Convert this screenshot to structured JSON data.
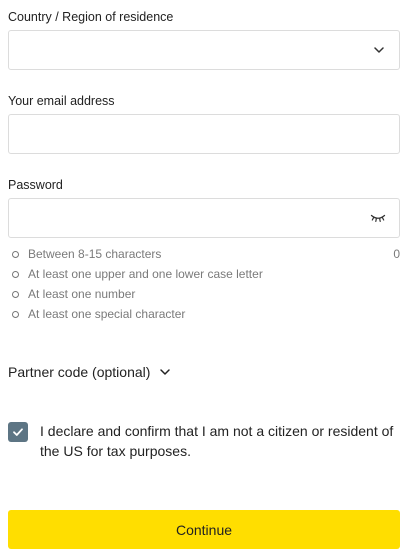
{
  "country": {
    "label": "Country / Region of residence",
    "value": ""
  },
  "email": {
    "label": "Your email address",
    "value": ""
  },
  "password": {
    "label": "Password",
    "value": "",
    "char_count": "0",
    "rules": [
      "Between 8-15 characters",
      "At least one upper and one lower case letter",
      "At least one number",
      "At least one special character"
    ]
  },
  "partner": {
    "label": "Partner code (optional)"
  },
  "declaration": {
    "text": "I declare and confirm that I am not a citizen or resident of the US for tax purposes.",
    "checked": true,
    "checkbox_color": "#5d7584"
  },
  "continue_button": {
    "label": "Continue",
    "color": "#ffde00"
  },
  "icons": {
    "country_select": "chevron-down-icon",
    "password_toggle": "eye-closed-icon",
    "partner_toggle": "chevron-down-icon",
    "checkbox": "checkmark-icon",
    "rule_bullet": "circle-bullet-icon"
  }
}
